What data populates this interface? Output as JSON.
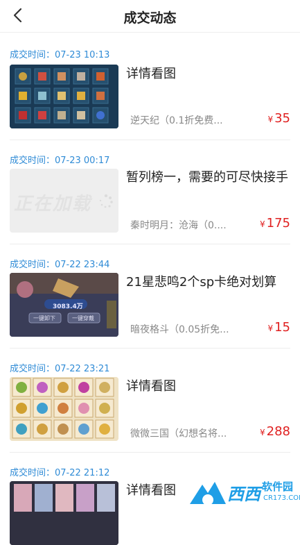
{
  "header": {
    "title": "成交动态"
  },
  "items": [
    {
      "time": "成交时间：07-23 10:13",
      "name": "详情看图",
      "game": "逆天纪（0.1折免费...",
      "currency": "¥",
      "price": "35"
    },
    {
      "time": "成交时间：07-23 00:17",
      "name": "暂列榜一，需要的可尽快接手",
      "game": "秦时明月：沧海（0....",
      "currency": "¥",
      "price": "175",
      "loading": "正在加载"
    },
    {
      "time": "成交时间：07-22 23:44",
      "name": "21星悲鸣2个sp卡绝对划算",
      "game": "暗夜格斗（0.05折免...",
      "currency": "¥",
      "price": "15",
      "thumb_text": {
        "power": "3083.4万",
        "btn_left": "一键卸下",
        "btn_right": "一键穿戴"
      }
    },
    {
      "time": "成交时间：07-22 23:21",
      "name": "详情看图",
      "game": "微微三国（幻想名将...",
      "currency": "¥",
      "price": "288"
    },
    {
      "time": "成交时间：07-22 21:12",
      "name": "详情看图"
    }
  ],
  "watermark": {
    "text": "西西",
    "sub": "软件园",
    "url": "CR173.COM"
  }
}
